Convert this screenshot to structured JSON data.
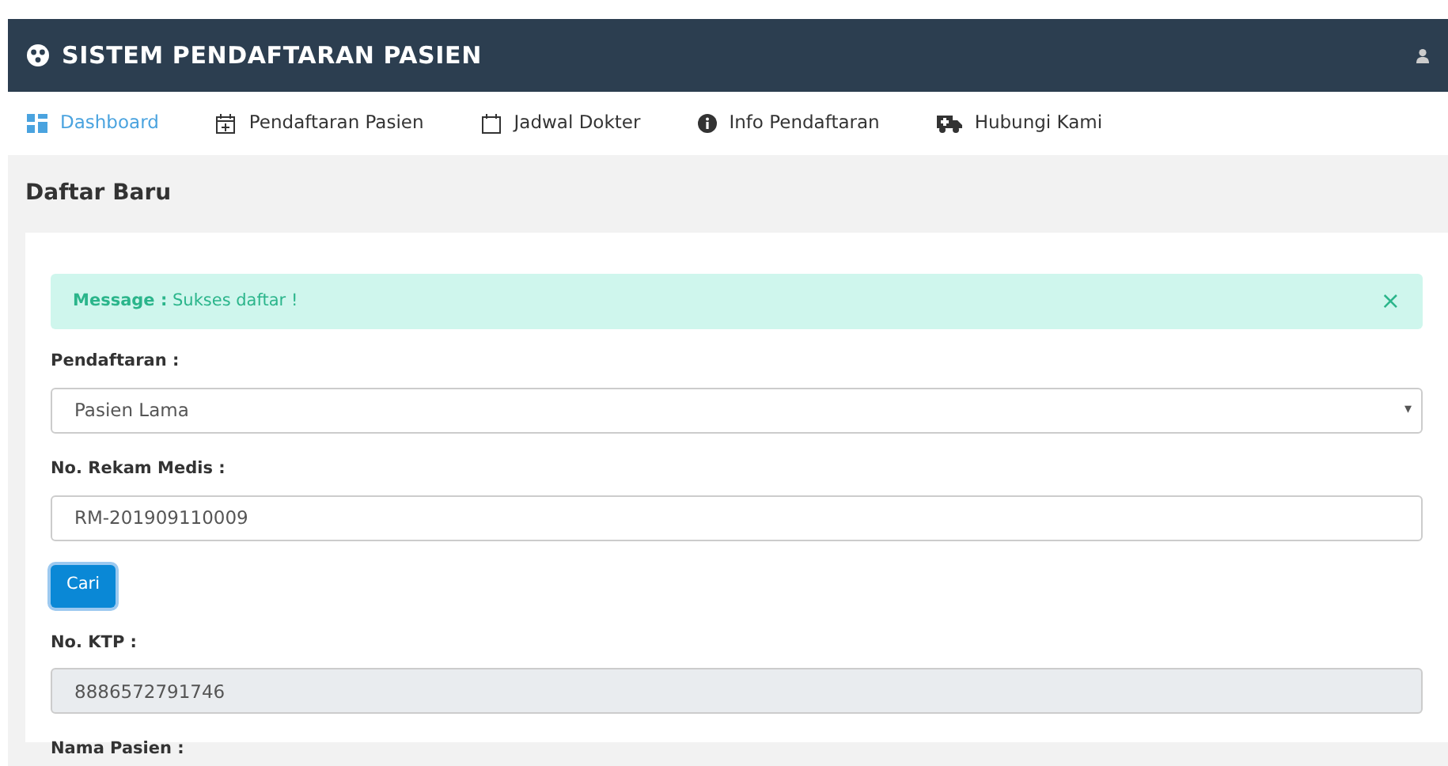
{
  "app": {
    "title": "SISTEM PENDAFTARAN PASIEN"
  },
  "nav": [
    {
      "label": "Dashboard",
      "selected": true
    },
    {
      "label": "Pendaftaran Pasien",
      "selected": false
    },
    {
      "label": "Jadwal Dokter",
      "selected": false
    },
    {
      "label": "Info Pendaftaran",
      "selected": false
    },
    {
      "label": "Hubungi Kami",
      "selected": false
    }
  ],
  "page_title": "Daftar Baru",
  "alert": {
    "label": "Message :",
    "text": "Sukses daftar !",
    "close": "×"
  },
  "form": [
    {
      "kind": "select",
      "label": "Pendaftaran :",
      "value": "Pasien Lama",
      "caret": "▾"
    },
    {
      "kind": "input",
      "label": "No. Rekam Medis :",
      "value": "RM-201909110009",
      "disabled": false
    },
    {
      "kind": "button",
      "text": "Cari"
    },
    {
      "kind": "input",
      "label": "No. KTP :",
      "value": "8886572791746",
      "disabled": true
    },
    {
      "kind": "label",
      "label": "Nama Pasien :"
    }
  ]
}
